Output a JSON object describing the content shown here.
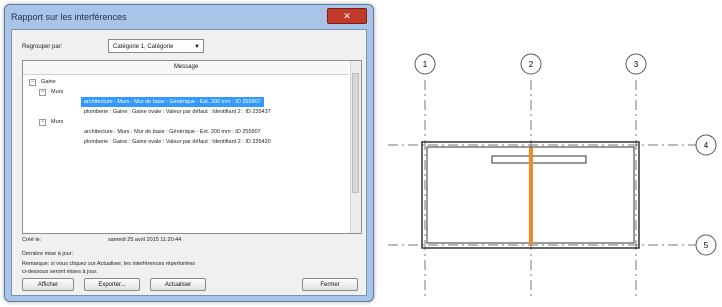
{
  "dialog": {
    "title": "Rapport sur les interférences",
    "close_label": "✕",
    "group_label": "Regrouper par:",
    "group_value": "Catégorie 1, Catégorie",
    "column_header": "Message",
    "tree": {
      "root": "Gaine",
      "groups": [
        {
          "label": "Murs",
          "items": [
            "architecture : Murs : Mur de base : Générique - Ext. 200 mm : ID 255907",
            "plomberie : Gaine : Gaine ovale : Valeur par défaut : Identifiant 2 : ID 235437"
          ]
        },
        {
          "label": "Murs",
          "items": [
            "architecture : Murs : Mur de base : Générique - Ext. 200 mm : ID 255907",
            "plomberie : Gaine : Gaine ovale : Valeur par défaut : Identifiant 2 : ID 235420"
          ]
        }
      ]
    },
    "created_label": "Créé le:",
    "created_value": "samedi 25 avril 2015 11:20:44",
    "last_update": "Dernière mise à jour:",
    "note_line1": "Remarque: si vous cliquez sur Actualiser, les interférences répertoriées",
    "note_line2": "ci-dessous seront mises à jour.",
    "buttons": {
      "show": "Afficher",
      "export": "Exporter...",
      "refresh": "Actualiser",
      "close": "Fermer"
    }
  },
  "plan": {
    "grid_labels_top": [
      "1",
      "2",
      "3"
    ],
    "grid_labels_right": [
      "4",
      "5"
    ],
    "colors": {
      "highlight": "#f08a24",
      "grid_line": "#777777",
      "wall": "#333333"
    }
  }
}
